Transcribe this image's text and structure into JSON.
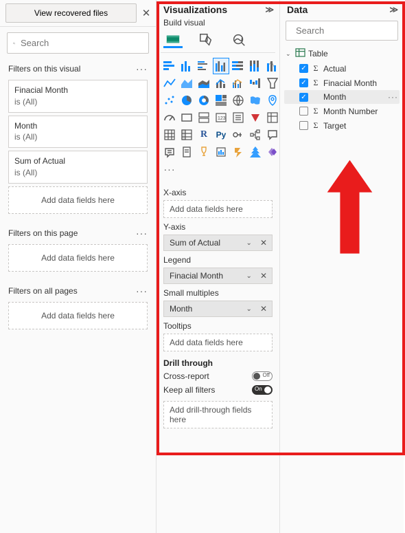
{
  "filters": {
    "recovered_btn": "View recovered files",
    "search_placeholder": "Search",
    "on_visual": {
      "title": "Filters on this visual",
      "items": [
        {
          "name": "Finacial Month",
          "state": "is (All)"
        },
        {
          "name": "Month",
          "state": "is (All)"
        },
        {
          "name": "Sum of Actual",
          "state": "is (All)"
        }
      ],
      "add_placeholder": "Add data fields here"
    },
    "on_page": {
      "title": "Filters on this page",
      "add_placeholder": "Add data fields here"
    },
    "on_all": {
      "title": "Filters on all pages",
      "add_placeholder": "Add data fields here"
    }
  },
  "viz": {
    "pane_title": "Visualizations",
    "build_label": "Build visual",
    "sections": {
      "xaxis": {
        "label": "X-axis",
        "placeholder": "Add data fields here"
      },
      "yaxis": {
        "label": "Y-axis",
        "value": "Sum of Actual"
      },
      "legend": {
        "label": "Legend",
        "value": "Finacial Month"
      },
      "small": {
        "label": "Small multiples",
        "value": "Month"
      },
      "tool": {
        "label": "Tooltips",
        "placeholder": "Add data fields here"
      }
    },
    "drill": {
      "title": "Drill through",
      "cross_label": "Cross-report",
      "cross_state": "Off",
      "keep_label": "Keep all filters",
      "keep_state": "On",
      "add_placeholder": "Add drill-through fields here"
    },
    "icons": [
      "stacked-bar-h",
      "stacked-bar-v",
      "clustered-bar-h",
      "clustered-bar-v",
      "100-stacked-h",
      "100-stacked-v",
      "ribbon",
      "line",
      "area",
      "stacked-area",
      "line-stacked-col",
      "line-clustered-col",
      "waterfall",
      "funnel",
      "scatter",
      "pie",
      "donut",
      "treemap",
      "map",
      "filled-map",
      "azure-map",
      "gauge",
      "card",
      "multi-row-card",
      "kpi",
      "slicer",
      "table",
      "matrix",
      "r-visual",
      "py-visual",
      "key-influencers",
      "decomposition",
      "qna",
      "smart-narrative",
      "paginated",
      "arcgis",
      "powerapps",
      "more"
    ]
  },
  "data": {
    "pane_title": "Data",
    "search_placeholder": "Search",
    "table_name": "Table",
    "fields": [
      {
        "name": "Actual",
        "checked": true,
        "sigma": true,
        "hover": false
      },
      {
        "name": "Finacial Month",
        "checked": true,
        "sigma": true,
        "hover": false
      },
      {
        "name": "Month",
        "checked": true,
        "sigma": false,
        "hover": true
      },
      {
        "name": "Month Number",
        "checked": false,
        "sigma": true,
        "hover": false
      },
      {
        "name": "Target",
        "checked": false,
        "sigma": true,
        "hover": false
      }
    ]
  },
  "chart_data": null
}
